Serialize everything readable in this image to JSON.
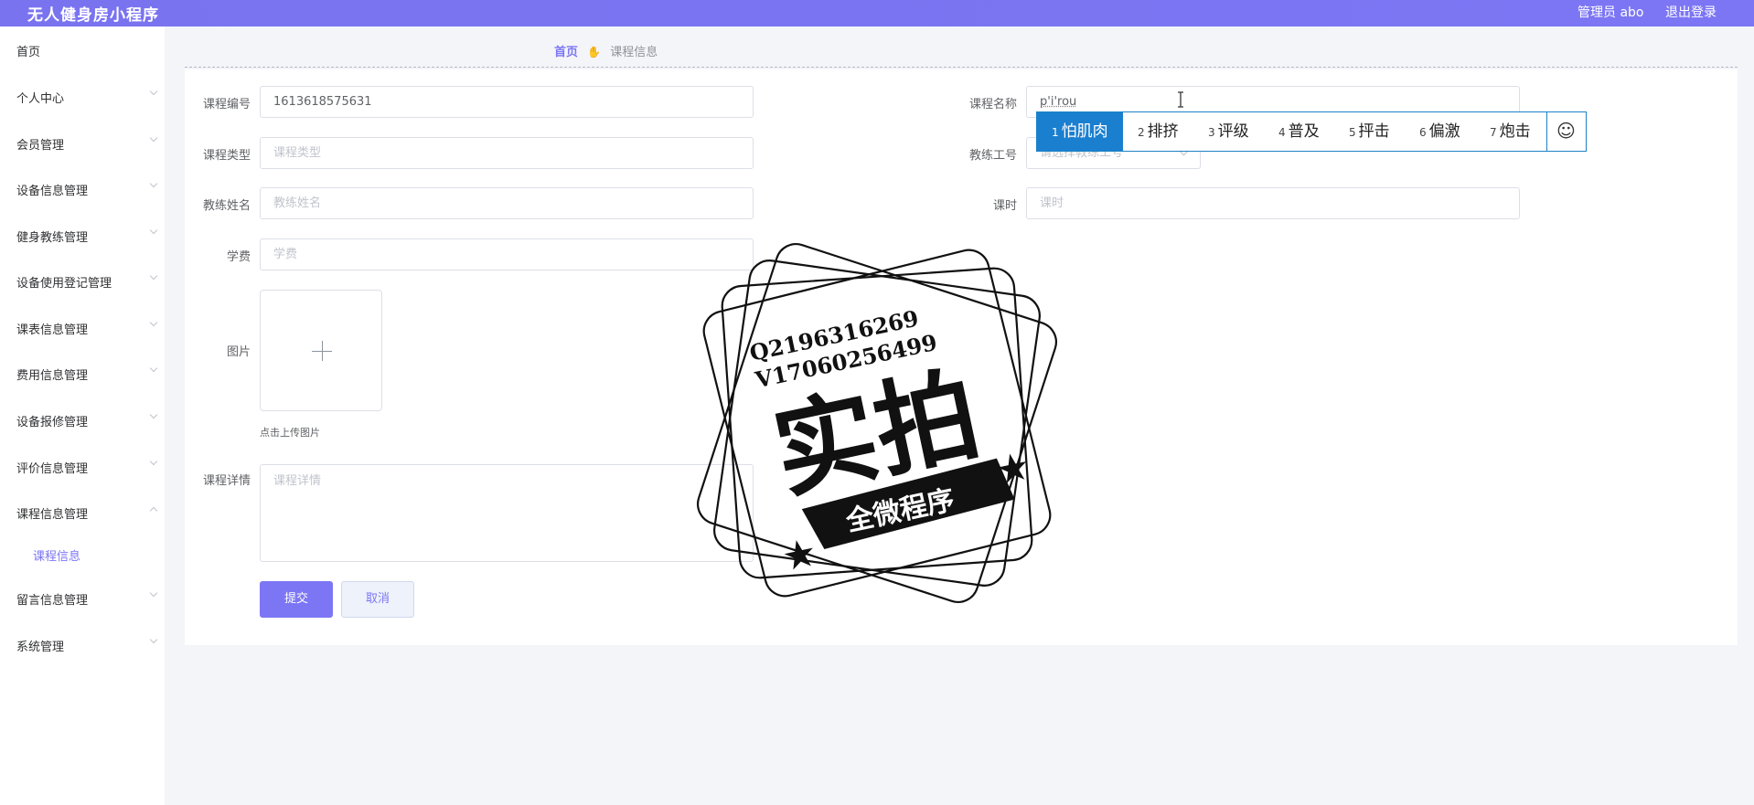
{
  "header": {
    "app_title": "无人健身房小程序",
    "admin_label": "管理员 abo",
    "logout_label": "退出登录"
  },
  "sidebar": {
    "items": [
      {
        "label": "首页"
      },
      {
        "label": "个人中心"
      },
      {
        "label": "会员管理"
      },
      {
        "label": "设备信息管理"
      },
      {
        "label": "健身教练管理"
      },
      {
        "label": "设备使用登记管理"
      },
      {
        "label": "课表信息管理"
      },
      {
        "label": "费用信息管理"
      },
      {
        "label": "设备报修管理"
      },
      {
        "label": "评价信息管理"
      },
      {
        "label": "课程信息管理"
      },
      {
        "label": "课程信息"
      },
      {
        "label": "留言信息管理"
      },
      {
        "label": "系统管理"
      }
    ]
  },
  "breadcrumb": {
    "home": "首页",
    "current": "课程信息"
  },
  "form": {
    "course_no_label": "课程编号",
    "course_no_value": "1613618575631",
    "course_name_label": "课程名称",
    "course_name_value": "p'i'rou",
    "course_type_label": "课程类型",
    "course_type_placeholder": "课程类型",
    "coach_id_label": "教练工号",
    "coach_id_placeholder": "请选择教练工号",
    "coach_name_label": "教练姓名",
    "coach_name_placeholder": "教练姓名",
    "hours_label": "课时",
    "hours_placeholder": "课时",
    "fee_label": "学费",
    "fee_placeholder": "学费",
    "image_label": "图片",
    "upload_hint": "点击上传图片",
    "detail_label": "课程详情",
    "detail_placeholder": "课程详情",
    "submit_label": "提交",
    "cancel_label": "取消"
  },
  "ime": {
    "candidates": [
      {
        "num": "1",
        "text": "怕肌肉"
      },
      {
        "num": "2",
        "text": "排挤"
      },
      {
        "num": "3",
        "text": "评级"
      },
      {
        "num": "4",
        "text": "普及"
      },
      {
        "num": "5",
        "text": "抨击"
      },
      {
        "num": "6",
        "text": "偏激"
      },
      {
        "num": "7",
        "text": "炮击"
      }
    ],
    "emoji": "☺"
  },
  "watermark": {
    "line1": "Q2196316269",
    "line2": "V17060256499",
    "big_text": "实拍",
    "banner_text": "全微程序"
  },
  "colors": {
    "accent": "#7c76f4",
    "ime_highlight": "#1b7fd0"
  }
}
